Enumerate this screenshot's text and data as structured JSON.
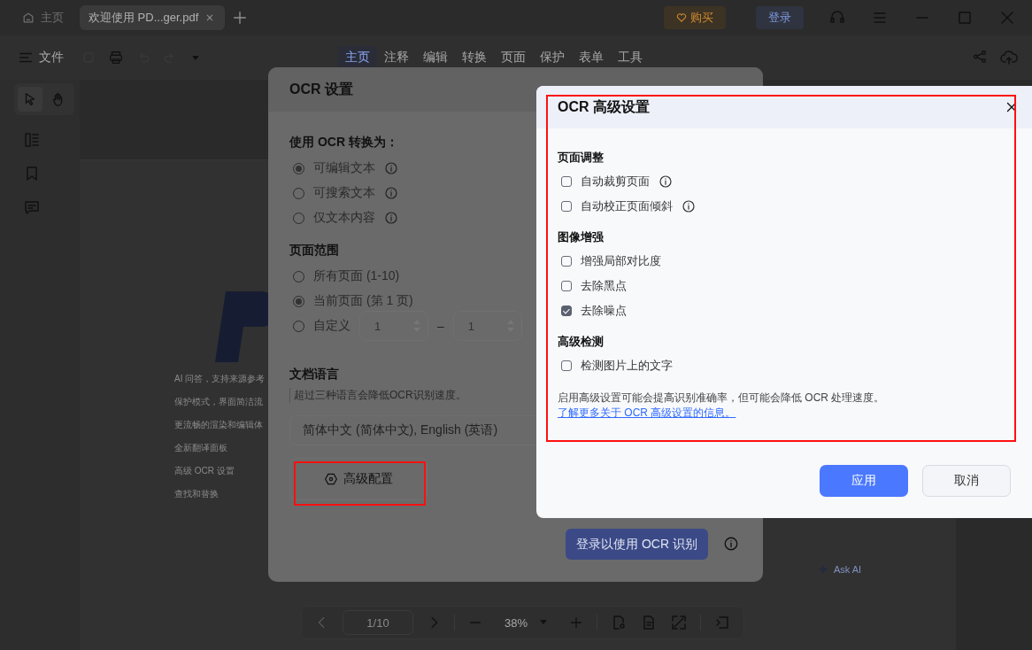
{
  "app_tabs": [
    {
      "label": "主页",
      "kind": "home",
      "selected": false
    },
    {
      "label": "欢迎使用 PD...ger.pdf",
      "kind": "doc",
      "selected": true
    }
  ],
  "title_actions": {
    "buy": "购买",
    "login": "登录"
  },
  "file_menu": "文件",
  "ribbon_tabs": [
    {
      "label": "主页",
      "selected": true
    },
    {
      "label": "注释",
      "selected": false
    },
    {
      "label": "编辑",
      "selected": false
    },
    {
      "label": "转换",
      "selected": false
    },
    {
      "label": "页面",
      "selected": false
    },
    {
      "label": "保护",
      "selected": false
    },
    {
      "label": "表单",
      "selected": false
    },
    {
      "label": "工具",
      "selected": false
    }
  ],
  "document": {
    "features": [
      "AI 问答，支持来源参考",
      "保护模式，界面简洁流",
      "更流畅的渲染和编辑体",
      "全新翻译面板",
      "高级 OCR 设置",
      "查找和替换"
    ],
    "ask_ai": "Ask AI"
  },
  "page_toolbar": {
    "page": "1/10",
    "zoom": "38%"
  },
  "ocr_dialog": {
    "title": "OCR 设置",
    "convert_label": "使用 OCR 转换为：",
    "convert_options": [
      {
        "label": "可编辑文本",
        "selected": true,
        "info": true
      },
      {
        "label": "可搜索文本",
        "selected": false,
        "info": true
      },
      {
        "label": "仅文本内容",
        "selected": false,
        "info": true
      }
    ],
    "range_label": "页面范围",
    "range_options": [
      {
        "label": "所有页面 (1-10)",
        "selected": false,
        "kind": "plain"
      },
      {
        "label": "当前页面 (第 1 页)",
        "selected": true,
        "kind": "plain"
      },
      {
        "label": "自定义",
        "selected": false,
        "kind": "custom"
      }
    ],
    "custom_from": "1",
    "range_dash": "–",
    "custom_to": "1",
    "language_label": "文档语言",
    "language_hint": "超过三种语言会降低OCR识别速度。",
    "language_value": "简体中文 (简体中文), English (英语)",
    "advanced_button": "高级配置",
    "login_button": "登录以使用 OCR 识别"
  },
  "advanced_dialog": {
    "title": "OCR 高级设置",
    "sections": [
      {
        "title": "页面调整",
        "items": [
          {
            "label": "自动裁剪页面",
            "checked": false,
            "info": true
          },
          {
            "label": "自动校正页面倾斜",
            "checked": false,
            "info": true
          }
        ]
      },
      {
        "title": "图像增强",
        "items": [
          {
            "label": "增强局部对比度",
            "checked": false,
            "info": false
          },
          {
            "label": "去除黑点",
            "checked": false,
            "info": false
          },
          {
            "label": "去除噪点",
            "checked": true,
            "info": false
          }
        ]
      },
      {
        "title": "高级检测",
        "items": [
          {
            "label": "检测图片上的文字",
            "checked": false,
            "info": false
          }
        ]
      }
    ],
    "note": "启用高级设置可能会提高识别准确率，但可能会降低 OCR 处理速度。",
    "link": "了解更多关于 OCR 高级设置的信息。",
    "apply": "应用",
    "cancel": "取消"
  }
}
